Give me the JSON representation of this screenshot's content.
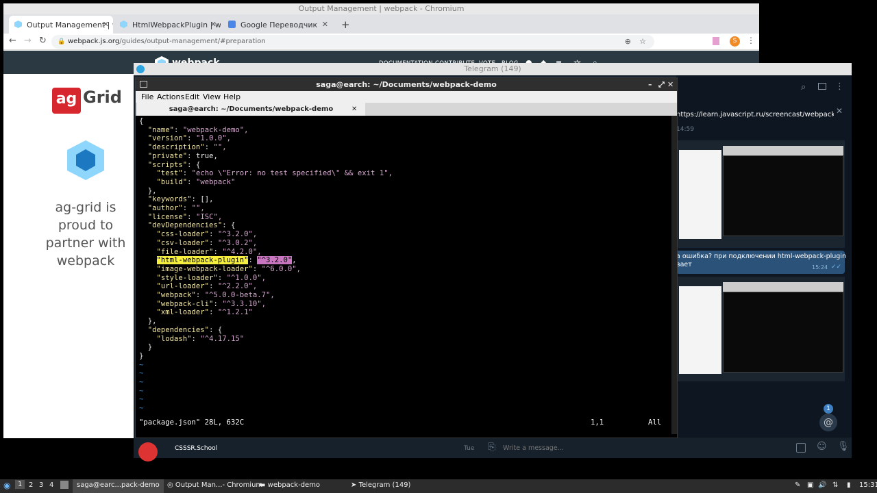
{
  "chromium": {
    "title": "Output Management | webpack - Chromium",
    "tabs": [
      {
        "label": "Output Management | we"
      },
      {
        "label": "HtmlWebpackPlugin | we"
      },
      {
        "label": "Google Переводчик"
      }
    ],
    "new_tab": "+",
    "url_host": "webpack.js.org",
    "url_path": "/guides/output-management/#preparation",
    "profile_initial": "S",
    "site": {
      "logo_text": "webpack",
      "nav": [
        "DOCUMENTATION",
        "CONTRIBUTE",
        "VOTE",
        "BLOG"
      ],
      "sponsor_brand_ag": "ag",
      "sponsor_brand_grid": "Grid",
      "sponsor_text": "ag-grid is proud to partner with webpack"
    }
  },
  "telegram": {
    "title": "Telegram (149)",
    "link_message": "https://learn.javascript.ru/screencast/webpack 👀",
    "time_1": "14:59",
    "message_2": "а ошибка? при подключении html-webpack-plugin\nвает",
    "time_2": "15:24",
    "badge_count": "1",
    "chat_name": "CSSSR.School",
    "chat_day": "Tue",
    "input_placeholder": "Write a message..."
  },
  "terminal": {
    "title": "saga@earch: ~/Documents/webpack-demo",
    "menu": [
      "File",
      "Actions",
      "Edit",
      "View",
      "Help"
    ],
    "tab_label": "saga@earch: ~/Documents/webpack-demo",
    "code_lines": [
      "{",
      "  \"name\": \"webpack-demo\",",
      "  \"version\": \"1.0.0\",",
      "  \"description\": \"\",",
      "  \"private\": true,",
      "  \"scripts\": {",
      "    \"test\": \"echo \\\"Error: no test specified\\\" && exit 1\",",
      "    \"build\": \"webpack\"",
      "  },",
      "  \"keywords\": [],",
      "  \"author\": \"\",",
      "  \"license\": \"ISC\",",
      "  \"devDependencies\": {",
      "    \"css-loader\": \"^3.2.0\",",
      "    \"csv-loader\": \"^3.0.2\",",
      "    \"file-loader\": \"^4.2.0\",",
      "    \"html-webpack-plugin\": \"^3.2.0\",",
      "    \"image-webpack-loader\": \"^6.0.0\",",
      "    \"style-loader\": \"^1.0.0\",",
      "    \"url-loader\": \"^2.2.0\",",
      "    \"webpack\": \"^5.0.0-beta.7\",",
      "    \"webpack-cli\": \"^3.3.10\",",
      "    \"xml-loader\": \"^1.2.1\"",
      "  },",
      "  \"dependencies\": {",
      "    \"lodash\": \"^4.17.15\"",
      "  }",
      "}"
    ],
    "status_file": "\"package.json\" 28L, 632C",
    "status_pos": "1,1",
    "status_all": "All"
  },
  "taskbar": {
    "workspaces": [
      "1",
      "2",
      "3",
      "4"
    ],
    "tasks": [
      "saga@earc...pack-demo",
      "Output Man...- Chromium",
      "webpack-demo",
      "Telegram (149)"
    ],
    "clock": "15:31"
  }
}
